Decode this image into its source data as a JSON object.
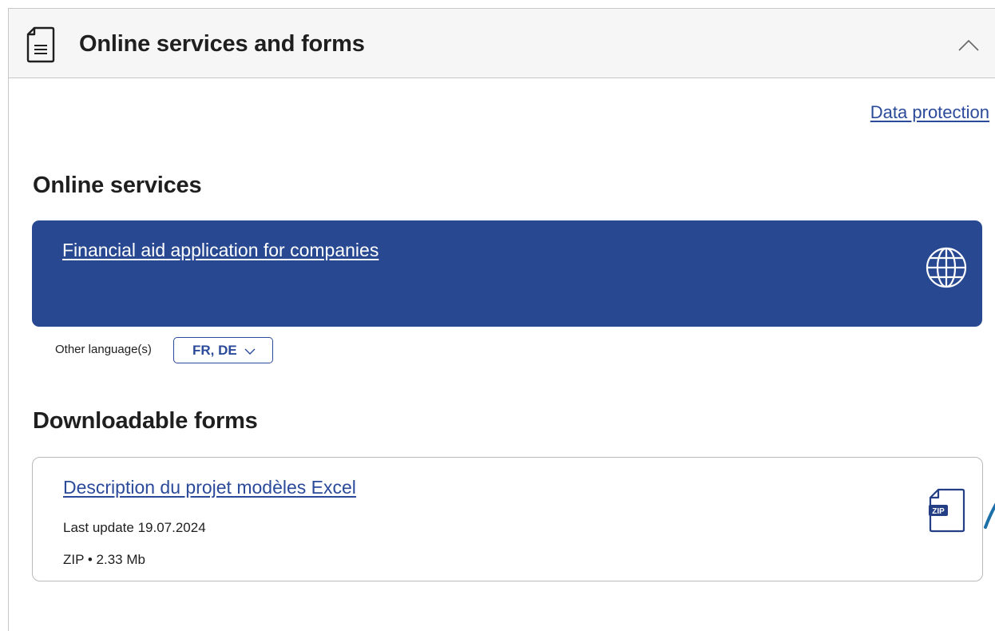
{
  "panel": {
    "title": "Online services and forms",
    "header_icon": "document-icon",
    "collapse_icon": "chevron-up-icon"
  },
  "links": {
    "data_protection": "Data protection"
  },
  "online_services": {
    "heading": "Online services",
    "items": [
      {
        "label": "Financial aid application for companies",
        "icon": "globe-icon",
        "other_languages_label": "Other language(s)",
        "languages_value": "FR, DE"
      }
    ]
  },
  "downloadable_forms": {
    "heading": "Downloadable forms",
    "items": [
      {
        "label": "Description du projet modèles Excel",
        "last_update": "Last update 19.07.2024",
        "file_info": "ZIP • 2.33 Mb",
        "icon": "zip-file-icon",
        "icon_text": "ZIP"
      }
    ]
  },
  "colors": {
    "accent": "#284991",
    "link": "#2b4a9a",
    "header_bg": "#f6f6f6",
    "border": "#c9c9c9"
  }
}
